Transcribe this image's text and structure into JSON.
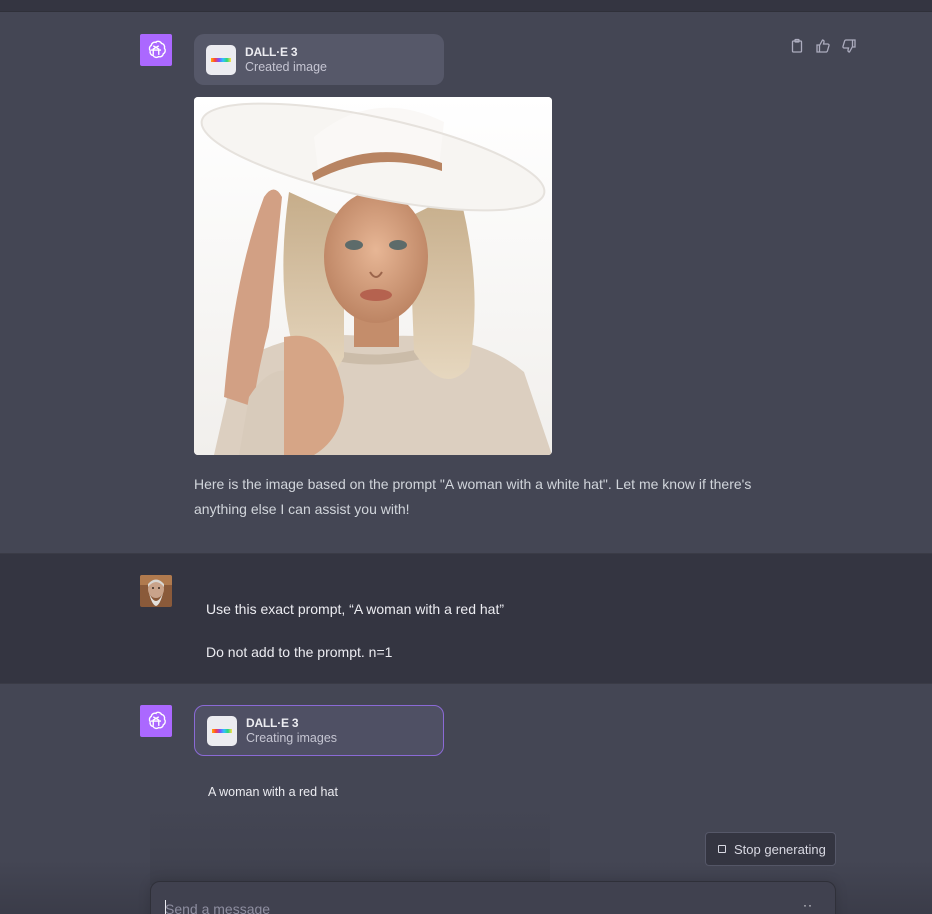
{
  "colors": {
    "assistant_bg": "#444654",
    "user_bg": "#343541",
    "gpt_avatar": "#ab68ff",
    "tool_pill": "#565869",
    "composer_bg": "#40414f"
  },
  "messages": {
    "assistant_1": {
      "tool": {
        "name": "DALL·E 3",
        "status": "Created image"
      },
      "image_description_icon": "generated-image",
      "text": "Here is the image based on the prompt \"A woman with a white hat\". Let me know if there's anything else I can assist you with!",
      "actions": [
        "clipboard-icon",
        "thumbs-up-icon",
        "thumbs-down-icon"
      ]
    },
    "user": {
      "line1": "Use this exact prompt, “A woman with a red hat”",
      "line2": "Do not add to the prompt. n=1"
    },
    "assistant_2": {
      "tool": {
        "name": "DALL·E 3",
        "status": "Creating images"
      },
      "prompt": "A woman with a red hat"
    }
  },
  "controls": {
    "stop_label": "Stop generating",
    "composer_placeholder": "Send a message",
    "composer_indicator": "··"
  }
}
